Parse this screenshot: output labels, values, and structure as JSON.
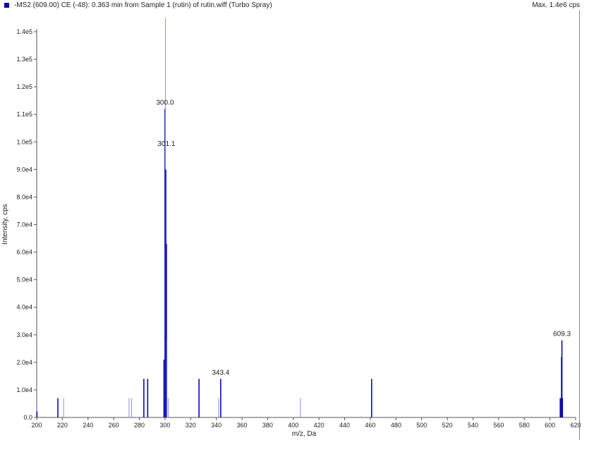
{
  "header": {
    "title": "-MS2 (609.00) CE (-48): 0.363 min from Sample 1 (rutin) of rutin.wiff (Turbo Spray)",
    "max_label": "Max. 1.4e6 cps"
  },
  "colors": {
    "series": "#0a0ab4",
    "series_light": "#8c8cf0",
    "axis": "#555555",
    "text": "#222222"
  },
  "chart_data": {
    "type": "bar",
    "xlabel": "m/z, Da",
    "ylabel": "Intensity, cps",
    "xlim": [
      200,
      620
    ],
    "ylim": [
      0,
      145000
    ],
    "x_ticks": [
      200,
      220,
      240,
      260,
      280,
      300,
      320,
      340,
      360,
      380,
      400,
      420,
      440,
      460,
      480,
      500,
      520,
      540,
      560,
      580,
      600,
      620
    ],
    "y_ticks": [
      {
        "value": 0,
        "label": "0.0"
      },
      {
        "value": 10000,
        "label": "1.0e4"
      },
      {
        "value": 20000,
        "label": "2.0e4"
      },
      {
        "value": 30000,
        "label": "3.0e4"
      },
      {
        "value": 40000,
        "label": "4.0e4"
      },
      {
        "value": 50000,
        "label": "5.0e4"
      },
      {
        "value": 60000,
        "label": "6.0e4"
      },
      {
        "value": 70000,
        "label": "7.0e4"
      },
      {
        "value": 80000,
        "label": "8.0e4"
      },
      {
        "value": 90000,
        "label": "9.0e4"
      },
      {
        "value": 100000,
        "label": "1.0e5"
      },
      {
        "value": 110000,
        "label": "1.1e5"
      },
      {
        "value": 120000,
        "label": "1.2e5"
      },
      {
        "value": 130000,
        "label": "1.3e5"
      },
      {
        "value": 140000,
        "label": "1.4e5"
      }
    ],
    "grid": false,
    "peaks": [
      {
        "mz": 200.2,
        "intensity": 2200,
        "weight": "strong"
      },
      {
        "mz": 216.5,
        "intensity": 7000,
        "weight": "strong"
      },
      {
        "mz": 221.0,
        "intensity": 7000,
        "weight": "light"
      },
      {
        "mz": 272.0,
        "intensity": 7000,
        "weight": "light"
      },
      {
        "mz": 274.0,
        "intensity": 7000,
        "weight": "light"
      },
      {
        "mz": 283.5,
        "intensity": 14000,
        "weight": "strong"
      },
      {
        "mz": 286.5,
        "intensity": 14000,
        "weight": "strong"
      },
      {
        "mz": 299.2,
        "intensity": 21000,
        "weight": "strong"
      },
      {
        "mz": 300.0,
        "intensity": 112000,
        "weight": "strong"
      },
      {
        "mz": 300.3,
        "intensity": 145000,
        "weight": "light"
      },
      {
        "mz": 300.6,
        "intensity": 90000,
        "weight": "strong"
      },
      {
        "mz": 301.1,
        "intensity": 63000,
        "weight": "strong"
      },
      {
        "mz": 301.5,
        "intensity": 28000,
        "weight": "light"
      },
      {
        "mz": 302.5,
        "intensity": 7000,
        "weight": "light"
      },
      {
        "mz": 326.5,
        "intensity": 14000,
        "weight": "strong"
      },
      {
        "mz": 341.8,
        "intensity": 7000,
        "weight": "light"
      },
      {
        "mz": 343.4,
        "intensity": 14000,
        "weight": "strong"
      },
      {
        "mz": 405.5,
        "intensity": 7000,
        "weight": "light"
      },
      {
        "mz": 461.0,
        "intensity": 14000,
        "weight": "strong"
      },
      {
        "mz": 608.0,
        "intensity": 7000,
        "weight": "strong"
      },
      {
        "mz": 608.6,
        "intensity": 7000,
        "weight": "strong"
      },
      {
        "mz": 609.0,
        "intensity": 22000,
        "weight": "strong"
      },
      {
        "mz": 609.3,
        "intensity": 28000,
        "weight": "strong"
      },
      {
        "mz": 609.7,
        "intensity": 7000,
        "weight": "strong"
      }
    ],
    "annotations": [
      {
        "text": "300.0",
        "mz": 300.0,
        "intensity": 112000
      },
      {
        "text": "301.1",
        "mz": 301.1,
        "intensity": 97000
      },
      {
        "text": "343.4",
        "mz": 343.4,
        "intensity": 14000
      },
      {
        "text": "609.3",
        "mz": 609.3,
        "intensity": 28000
      }
    ]
  }
}
